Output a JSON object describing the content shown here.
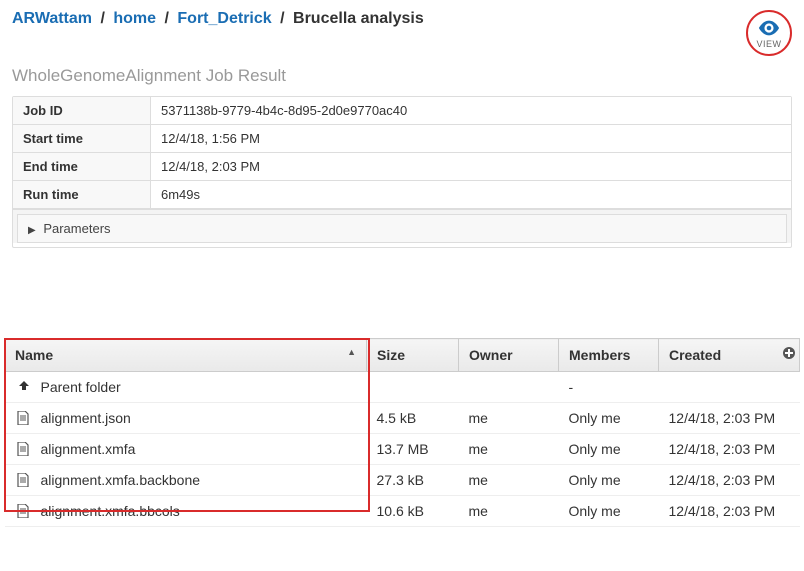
{
  "breadcrumb": {
    "parts": [
      "ARWattam",
      "home",
      "Fort_Detrick"
    ],
    "current": "Brucella analysis"
  },
  "view_button": {
    "label": "VIEW"
  },
  "subtitle": "WholeGenomeAlignment Job Result",
  "meta": {
    "job_id_label": "Job ID",
    "job_id": "5371138b-9779-4b4c-8d95-2d0e9770ac40",
    "start_label": "Start time",
    "start": "12/4/18, 1:56 PM",
    "end_label": "End time",
    "end": "12/4/18, 2:03 PM",
    "run_label": "Run time",
    "run": "6m49s",
    "params_label": "Parameters"
  },
  "columns": {
    "name": "Name",
    "size": "Size",
    "owner": "Owner",
    "members": "Members",
    "created": "Created"
  },
  "parent_folder_label": "Parent folder",
  "files": [
    {
      "name": "alignment.json",
      "size": "4.5 kB",
      "owner": "me",
      "members": "Only me",
      "created": "12/4/18, 2:03 PM"
    },
    {
      "name": "alignment.xmfa",
      "size": "13.7 MB",
      "owner": "me",
      "members": "Only me",
      "created": "12/4/18, 2:03 PM"
    },
    {
      "name": "alignment.xmfa.backbone",
      "size": "27.3 kB",
      "owner": "me",
      "members": "Only me",
      "created": "12/4/18, 2:03 PM"
    },
    {
      "name": "alignment.xmfa.bbcols",
      "size": "10.6 kB",
      "owner": "me",
      "members": "Only me",
      "created": "12/4/18, 2:03 PM"
    }
  ]
}
